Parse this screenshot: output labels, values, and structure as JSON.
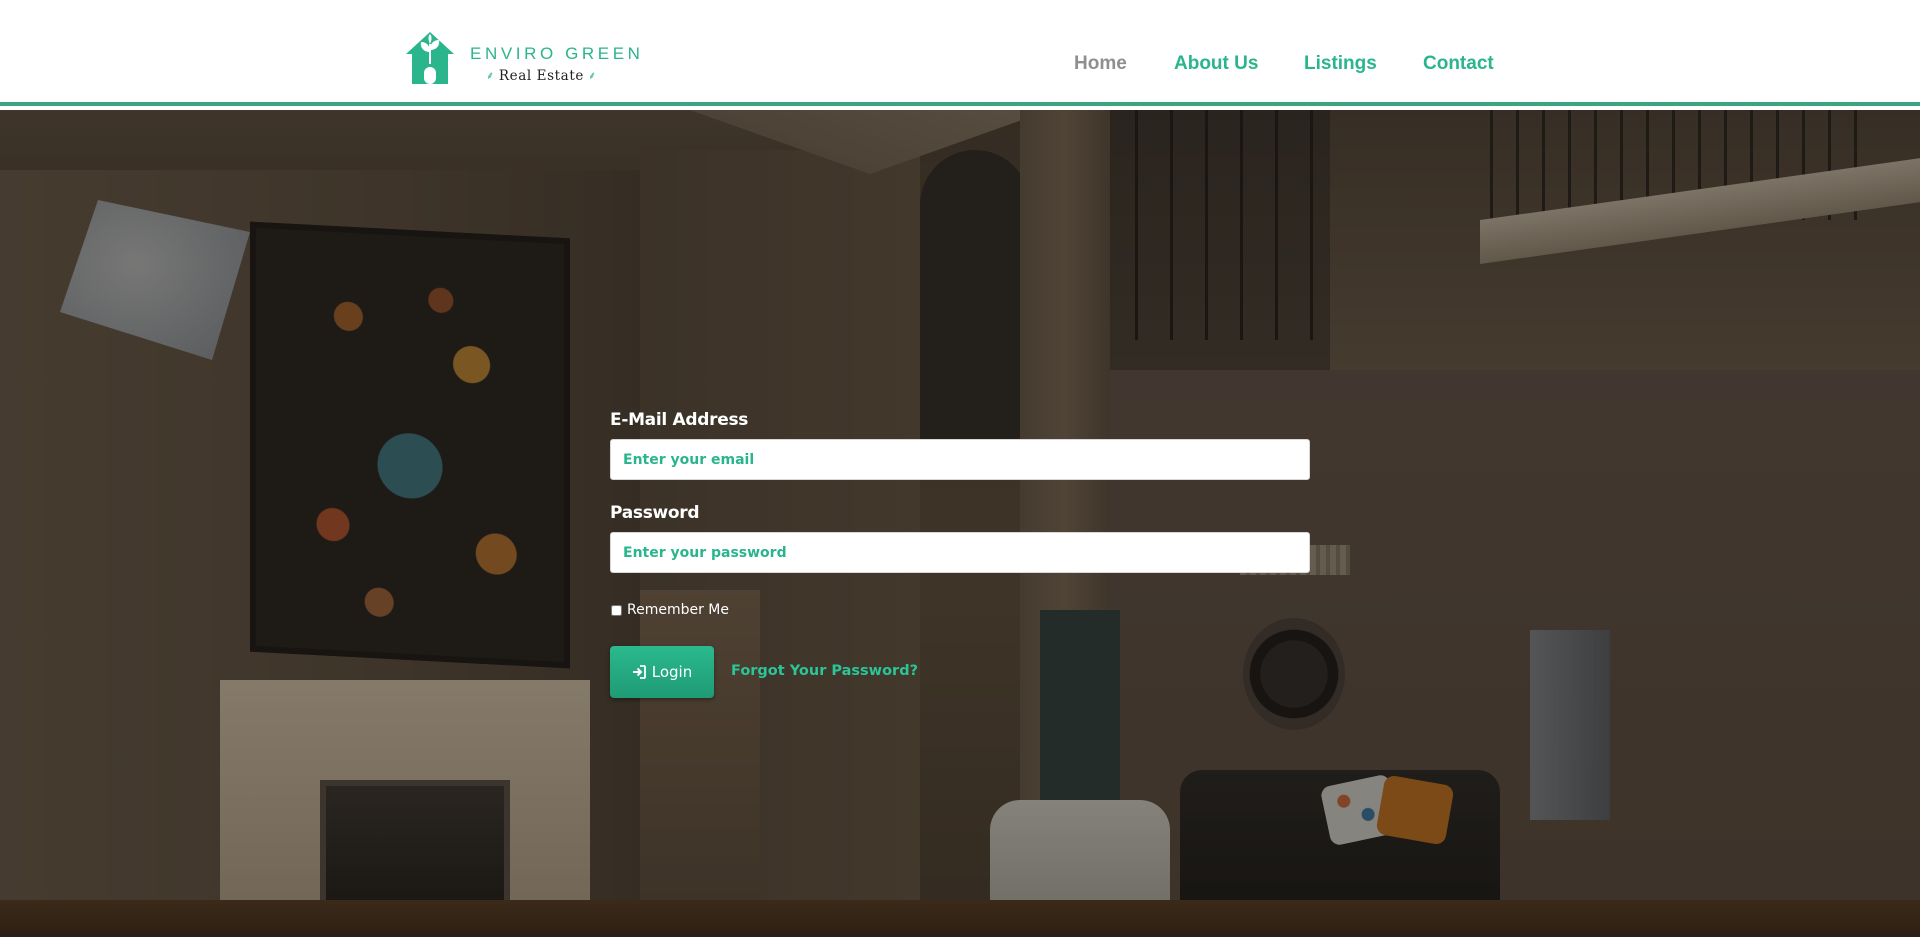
{
  "brand": {
    "name_line1": "ENVIRO GREEN",
    "name_line2": "Real Estate",
    "leaf_glyph": "⸙",
    "logo_icon": "house-leaf-icon",
    "color": "#2bb58c"
  },
  "nav": {
    "items": [
      {
        "label": "Home",
        "current": true
      },
      {
        "label": "About Us",
        "current": false
      },
      {
        "label": "Listings",
        "current": false
      },
      {
        "label": "Contact",
        "current": false
      }
    ]
  },
  "login": {
    "email_label": "E-Mail Address",
    "email_placeholder": "Enter your email",
    "email_value": "",
    "password_label": "Password",
    "password_placeholder": "Enter your password",
    "password_value": "",
    "remember_label": "Remember Me",
    "remember_checked": false,
    "submit_label": "Login",
    "submit_icon": "sign-in-icon",
    "forgot_label": "Forgot Your Password?"
  },
  "colors": {
    "accent": "#2bb58c",
    "header_border": "#3aa57f",
    "nav_current": "#8f8f8f"
  }
}
